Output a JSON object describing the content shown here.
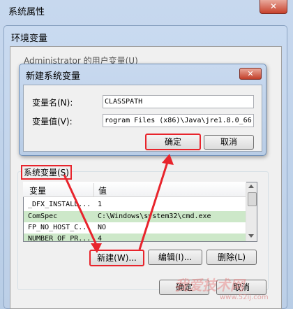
{
  "outer_window": {
    "title": "系统属性",
    "close_glyph": "✕"
  },
  "env_dialog": {
    "title": "环境变量",
    "user_vars_label": "Administrator 的用户变量(U)"
  },
  "new_var_dialog": {
    "title": "新建系统变量",
    "close_glyph": "✕",
    "name_label": "变量名(N):",
    "name_value": "CLASSPATH",
    "value_label": "变量值(V):",
    "value_value": "rogram Files (x86)\\Java\\jre1.8.0_66",
    "ok_label": "确定",
    "cancel_label": "取消"
  },
  "system_vars": {
    "label": "系统变量(S)",
    "columns": [
      "变量",
      "值"
    ],
    "rows": [
      {
        "name": "_DFX_INSTALL...",
        "value": "1"
      },
      {
        "name": "ComSpec",
        "value": "C:\\Windows\\system32\\cmd.exe"
      },
      {
        "name": "FP_NO_HOST_C...",
        "value": "NO"
      },
      {
        "name": "NUMBER_OF_PR...",
        "value": "4"
      }
    ],
    "new_label": "新建(W)...",
    "edit_label": "编辑(I)...",
    "delete_label": "删除(L)"
  },
  "bottom_buttons": {
    "ok_label": "确定",
    "cancel_label": "取消"
  },
  "watermark": {
    "text": "我爱技术网",
    "url": "www.52ij.com"
  },
  "colors": {
    "highlight": "#e8242c",
    "selected_row": "#cde8c9"
  }
}
